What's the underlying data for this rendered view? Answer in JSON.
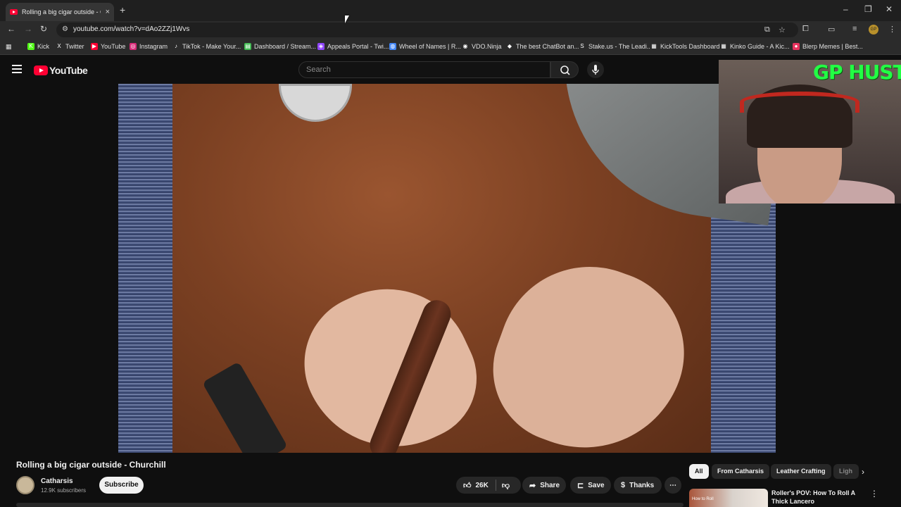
{
  "browser": {
    "tab_title": "Rolling a big cigar outside - Churchill",
    "tab_title_display": "Rolling a big cigar outside - Ch",
    "new_tab": "+",
    "tab_close": "×",
    "url": "youtube.com/watch?v=dAo2ZZj1Wvs",
    "window_minimize": "–",
    "window_restore": "❐",
    "window_close": "✕",
    "profile_initials": "GP",
    "bookmarks": [
      {
        "label": "Kick",
        "color": "#53fc18",
        "glyph": "K"
      },
      {
        "label": "Twitter",
        "color": "#2b2b2b",
        "glyph": "X"
      },
      {
        "label": "YouTube",
        "color": "#ff0033",
        "glyph": "▶"
      },
      {
        "label": "Instagram",
        "color": "#d62976",
        "glyph": "◎"
      },
      {
        "label": "TikTok - Make Your...",
        "color": "#2b2b2b",
        "glyph": "♪"
      },
      {
        "label": "Dashboard / Stream...",
        "color": "#3fb950",
        "glyph": "▤"
      },
      {
        "label": "Appeals Portal - Twi...",
        "color": "#9146ff",
        "glyph": "◈"
      },
      {
        "label": "Wheel of Names | R...",
        "color": "#4285f4",
        "glyph": "◍"
      },
      {
        "label": "VDO.Ninja",
        "color": "#2b2b2b",
        "glyph": "◉"
      },
      {
        "label": "The best ChatBot an...",
        "color": "#2b2b2b",
        "glyph": "◆"
      },
      {
        "label": "Stake.us - The Leadi...",
        "color": "#2b2b2b",
        "glyph": "S"
      },
      {
        "label": "KickTools Dashboard",
        "color": "#2b2b2b",
        "glyph": "▦"
      },
      {
        "label": "Kinko Guide - A Kic...",
        "color": "#2b2b2b",
        "glyph": "▦"
      },
      {
        "label": "Blerp Memes | Best...",
        "color": "#e8335e",
        "glyph": "●"
      }
    ]
  },
  "youtube": {
    "logo_text": "YouTube",
    "search_placeholder": "Search",
    "video": {
      "title": "Rolling a big cigar outside - Churchill",
      "channel": "Catharsis",
      "subscribers": "12.9K subscribers",
      "subscribe_label": "Subscribe",
      "likes": "26K",
      "share_label": "Share",
      "save_label": "Save",
      "thanks_label": "Thanks",
      "more_label": "⋯"
    },
    "chips": [
      "All",
      "From Catharsis",
      "Leather Crafting",
      "Ligh"
    ],
    "recommended": {
      "title": "Roller's POV: How To Roll A Thick Lancero",
      "thumb_text": "How to Roll"
    }
  },
  "overlay": {
    "text": "GP HUSTLA"
  }
}
